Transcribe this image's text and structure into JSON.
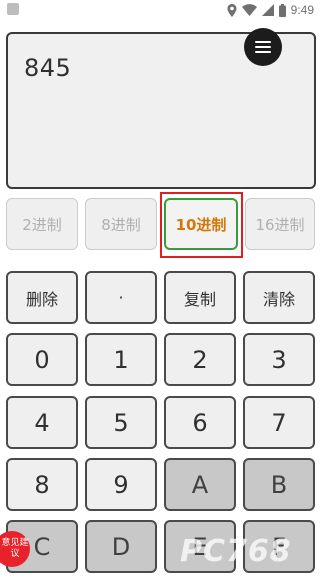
{
  "status_bar": {
    "time": "9:49"
  },
  "display": {
    "value": "845"
  },
  "radix_buttons": [
    {
      "label": "2进制",
      "active": false
    },
    {
      "label": "8进制",
      "active": false
    },
    {
      "label": "10进制",
      "active": true
    },
    {
      "label": "16进制",
      "active": false
    }
  ],
  "actions": {
    "delete": "删除",
    "dot": "·",
    "copy": "复制",
    "clear": "清除"
  },
  "keys": {
    "k0": "0",
    "k1": "1",
    "k2": "2",
    "k3": "3",
    "k4": "4",
    "k5": "5",
    "k6": "6",
    "k7": "7",
    "k8": "8",
    "k9": "9",
    "kA": "A",
    "kB": "B",
    "kC": "C",
    "kD": "D",
    "kE": "E",
    "kF": "F"
  },
  "feedback": {
    "label": "意见建议"
  },
  "watermark": {
    "text": "PC768"
  },
  "colors": {
    "active_text": "#d4780a",
    "active_border": "#3b9a3b",
    "highlight": "#e02020",
    "feedback_bg": "#e8222a"
  }
}
